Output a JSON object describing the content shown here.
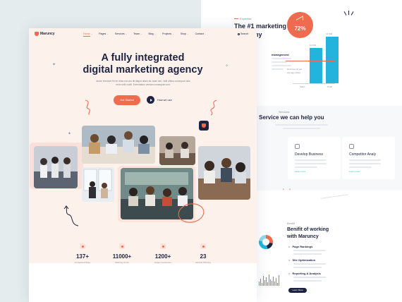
{
  "brand": {
    "name": "Maruncy",
    "accent": "#ef6b4f",
    "navy": "#1d2340",
    "cyan": "#24b3dc"
  },
  "nav": {
    "items": [
      {
        "label": "Home",
        "active": true
      },
      {
        "label": "Pages",
        "active": false
      },
      {
        "label": "Services",
        "active": false
      },
      {
        "label": "Team",
        "active": false
      },
      {
        "label": "Blog",
        "active": false
      },
      {
        "label": "Projects",
        "active": false
      },
      {
        "label": "Shop",
        "active": false
      },
      {
        "label": "Contact",
        "active": false
      }
    ],
    "search_label": "Search"
  },
  "hero": {
    "title_line1": "A fully integrated",
    "title_line2": "digital marketing agency",
    "description": "Andre tincidunt fin ter dicta est ulm dit aliqua aliam dic ande sint. Velit officia consequat duis enim velit mollit. Exercitation veniam consequat sunt.",
    "cta_label": "Get Started",
    "video_label": "How we use"
  },
  "stats": [
    {
      "value": "137+",
      "label": "Completed Sites",
      "icon": "briefcase-icon"
    },
    {
      "value": "11000+",
      "label": "Working Hours",
      "icon": "clock-icon"
    },
    {
      "value": "1200+",
      "label": "Happy Customers",
      "icon": "users-icon"
    },
    {
      "value": "23",
      "label": "Awards Winning",
      "icon": "trophy-icon"
    }
  ],
  "back_page": {
    "about_crumb": "Expertise",
    "about_title": "The #1 marketing company",
    "management_label": "management",
    "percent": "72%",
    "bar_labels": [
      "Sales",
      "Profit"
    ],
    "bar_values": [
      "10,000",
      "12,540"
    ],
    "chart_note": "Revenue on our average dates",
    "services_crumb": "Services",
    "services_title": "Service we can help you",
    "service_cards": [
      {
        "title": "ng",
        "link": ""
      },
      {
        "title": "Develop Business",
        "link": "Learn more"
      },
      {
        "title": "Competitor Analy",
        "link": "Learn more"
      }
    ],
    "benefit_crumb": "Benifit",
    "benefit_title": "Benifit of working with Maruncy",
    "benefit_items": [
      "Page Rankings",
      "Site Optimization",
      "Reporting & Analysis"
    ],
    "benefit_button": "Learn More"
  }
}
